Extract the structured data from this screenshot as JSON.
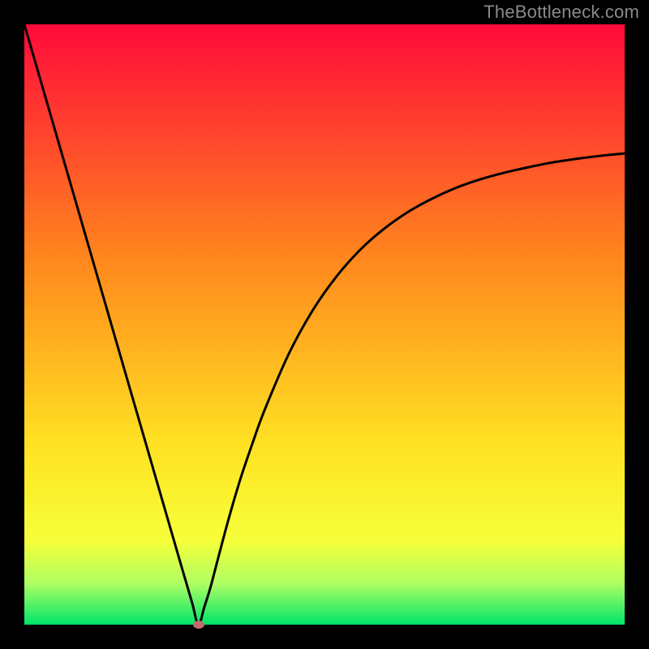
{
  "watermark": "TheBottleneck.com",
  "colors": {
    "top": "#ff0a3a",
    "upper_mid": "#ff8a1d",
    "mid": "#ffe222",
    "lower_mid": "#f6ff3a",
    "green_top": "#b0ff62",
    "green": "#00e56a",
    "curve": "#000000",
    "marker": "#c26b6b",
    "bg": "#000000"
  },
  "chart_data": {
    "type": "line",
    "title": "",
    "xlabel": "",
    "ylabel": "",
    "xlim": [
      0,
      100
    ],
    "ylim": [
      0,
      100
    ],
    "x": [
      0,
      2,
      4,
      6,
      8,
      10,
      12,
      14,
      16,
      18,
      20,
      22,
      24,
      26,
      27,
      28,
      29,
      30,
      31,
      32,
      34,
      36,
      38,
      40,
      44,
      48,
      52,
      56,
      60,
      64,
      68,
      72,
      76,
      80,
      84,
      88,
      92,
      96,
      100
    ],
    "series": [
      {
        "name": "bottleneck-curve",
        "values": [
          100,
          93.1,
          86.2,
          79.3,
          72.4,
          65.5,
          58.6,
          51.7,
          44.8,
          37.9,
          31.0,
          24.1,
          17.2,
          10.3,
          6.9,
          3.45,
          0.0,
          3.0,
          6.2,
          10.0,
          17.5,
          24.3,
          30.2,
          35.7,
          45.0,
          52.3,
          58.0,
          62.5,
          66.0,
          68.8,
          71.0,
          72.8,
          74.2,
          75.3,
          76.2,
          77.0,
          77.6,
          78.1,
          78.5
        ]
      }
    ],
    "marker": {
      "x": 29,
      "y": 0
    },
    "gradient_stops": [
      {
        "pos": 0.0,
        "color": "#ff0a3a"
      },
      {
        "pos": 0.4,
        "color": "#ff8a1d"
      },
      {
        "pos": 0.7,
        "color": "#ffe222"
      },
      {
        "pos": 0.86,
        "color": "#f6ff3a"
      },
      {
        "pos": 0.93,
        "color": "#b0ff62"
      },
      {
        "pos": 1.0,
        "color": "#00e56a"
      }
    ]
  }
}
